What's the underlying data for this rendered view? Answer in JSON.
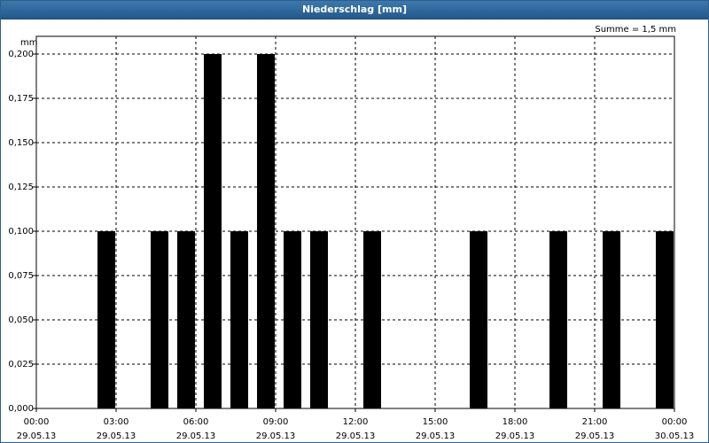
{
  "window": {
    "title": "Niederschlag [mm]"
  },
  "summary": {
    "text": "Summe = 1,5 mm"
  },
  "chart_data": {
    "type": "bar",
    "title": "Niederschlag [mm]",
    "ylabel": "mm",
    "xlabel": "",
    "ylim": [
      0,
      0.2
    ],
    "yticks": [
      {
        "value": 0,
        "label": "0,000"
      },
      {
        "value": 0.025,
        "label": "0,025"
      },
      {
        "value": 0.05,
        "label": "0,050"
      },
      {
        "value": 0.075,
        "label": "0,075"
      },
      {
        "value": 0.1,
        "label": "0,100"
      },
      {
        "value": 0.125,
        "label": "0,125"
      },
      {
        "value": 0.15,
        "label": "0,150"
      },
      {
        "value": 0.175,
        "label": "0,175"
      },
      {
        "value": 0.2,
        "label": "0,200"
      }
    ],
    "xlim": [
      "29.05.13 00:00",
      "30.05.13 00:00"
    ],
    "xticks": [
      {
        "hour": 0,
        "time": "00:00",
        "date": "29.05.13"
      },
      {
        "hour": 3,
        "time": "03:00",
        "date": "29.05.13"
      },
      {
        "hour": 6,
        "time": "06:00",
        "date": "29.05.13"
      },
      {
        "hour": 9,
        "time": "09:00",
        "date": "29.05.13"
      },
      {
        "hour": 12,
        "time": "12:00",
        "date": "29.05.13"
      },
      {
        "hour": 15,
        "time": "15:00",
        "date": "29.05.13"
      },
      {
        "hour": 18,
        "time": "18:00",
        "date": "29.05.13"
      },
      {
        "hour": 21,
        "time": "21:00",
        "date": "29.05.13"
      },
      {
        "hour": 24,
        "time": "00:00",
        "date": "30.05.13"
      }
    ],
    "bar_hours": [
      3,
      5,
      6,
      7,
      8,
      9,
      10,
      11,
      13,
      17,
      20,
      22,
      24
    ],
    "values": [
      0.1,
      0.1,
      0.1,
      0.2,
      0.1,
      0.2,
      0.1,
      0.1,
      0.1,
      0.1,
      0.1,
      0.1,
      0.1
    ],
    "bar_color": "#000000",
    "grid": true
  }
}
